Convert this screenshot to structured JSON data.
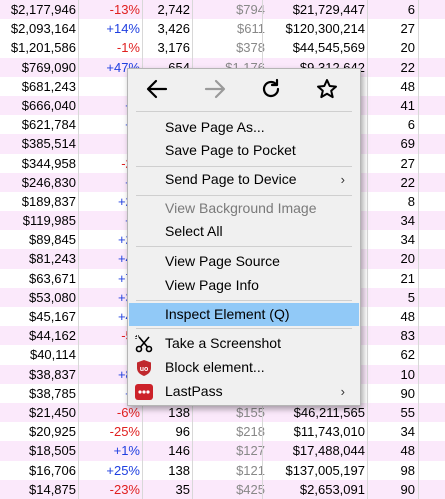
{
  "rows": [
    {
      "c1": "$2,177,946",
      "c2": "-13%",
      "c3": "2,742",
      "c4": "$794",
      "c5": "$21,729,447",
      "c6": "6",
      "style": "alt",
      "sign": "neg"
    },
    {
      "c1": "$2,093,164",
      "c2": "+14%",
      "c3": "3,426",
      "c4": "$611",
      "c5": "$120,300,214",
      "c6": "27",
      "style": "",
      "sign": "pos"
    },
    {
      "c1": "$1,201,586",
      "c2": "-1%",
      "c3": "3,176",
      "c4": "$378",
      "c5": "$44,545,569",
      "c6": "20",
      "style": "",
      "sign": "neg"
    },
    {
      "c1": "$769,090",
      "c2": "+47%",
      "c3": "654",
      "c4": "$1,176",
      "c5": "$9,312,642",
      "c6": "22",
      "style": "alt",
      "sign": "pos"
    },
    {
      "c1": "$681,243",
      "c2": "-3",
      "c3": "",
      "c4": "",
      "c5": "",
      "c6": "48",
      "style": "",
      "sign": "neg"
    },
    {
      "c1": "$666,040",
      "c2": "+5",
      "c3": "",
      "c4": "",
      "c5": "",
      "c6": "41",
      "style": "alt",
      "sign": "pos"
    },
    {
      "c1": "$621,784",
      "c2": "+3",
      "c3": "",
      "c4": "",
      "c5": "",
      "c6": "6",
      "style": "",
      "sign": "pos"
    },
    {
      "c1": "$385,514",
      "c2": "-2",
      "c3": "",
      "c4": "",
      "c5": "",
      "c6": "69",
      "style": "alt",
      "sign": "neg"
    },
    {
      "c1": "$344,958",
      "c2": "-22",
      "c3": "",
      "c4": "",
      "c5": "",
      "c6": "27",
      "style": "",
      "sign": "neg"
    },
    {
      "c1": "$246,830",
      "c2": "+5",
      "c3": "",
      "c4": "",
      "c5": "",
      "c6": "22",
      "style": "alt",
      "sign": "pos"
    },
    {
      "c1": "$189,837",
      "c2": "+21",
      "c3": "",
      "c4": "",
      "c5": "",
      "c6": "8",
      "style": "",
      "sign": "pos"
    },
    {
      "c1": "$119,985",
      "c2": "+8",
      "c3": "",
      "c4": "",
      "c5": "",
      "c6": "34",
      "style": "alt",
      "sign": "pos"
    },
    {
      "c1": "$89,845",
      "c2": "+29",
      "c3": "",
      "c4": "",
      "c5": "",
      "c6": "34",
      "style": "",
      "sign": "pos"
    },
    {
      "c1": "$81,243",
      "c2": "+41",
      "c3": "",
      "c4": "",
      "c5": "",
      "c6": "20",
      "style": "alt",
      "sign": "pos"
    },
    {
      "c1": "$63,671",
      "c2": "+73",
      "c3": "",
      "c4": "",
      "c5": "",
      "c6": "21",
      "style": "",
      "sign": "pos"
    },
    {
      "c1": "$53,080",
      "c2": "+30",
      "c3": "",
      "c4": "",
      "c5": "",
      "c6": "5",
      "style": "alt",
      "sign": "pos"
    },
    {
      "c1": "$45,167",
      "c2": "+45",
      "c3": "",
      "c4": "",
      "c5": "",
      "c6": "48",
      "style": "",
      "sign": "pos"
    },
    {
      "c1": "$44,162",
      "c2": "-51",
      "c3": "",
      "c4": "",
      "c5": "",
      "c6": "83",
      "style": "alt",
      "sign": "neg"
    },
    {
      "c1": "$40,114",
      "c2": "-2",
      "c3": "",
      "c4": "",
      "c5": "",
      "c6": "62",
      "style": "",
      "sign": "neg"
    },
    {
      "c1": "$38,837",
      "c2": "+80",
      "c3": "",
      "c4": "",
      "c5": "",
      "c6": "10",
      "style": "alt",
      "sign": "pos"
    },
    {
      "c1": "$38,785",
      "c2": "+4",
      "c3": "",
      "c4": "",
      "c5": "",
      "c6": "90",
      "style": "",
      "sign": "pos"
    },
    {
      "c1": "$21,450",
      "c2": "-6%",
      "c3": "138",
      "c4": "$155",
      "c5": "$46,211,565",
      "c6": "55",
      "style": "alt",
      "sign": "neg"
    },
    {
      "c1": "$20,925",
      "c2": "-25%",
      "c3": "96",
      "c4": "$218",
      "c5": "$11,743,010",
      "c6": "34",
      "style": "",
      "sign": "neg"
    },
    {
      "c1": "$18,505",
      "c2": "+1%",
      "c3": "146",
      "c4": "$127",
      "c5": "$17,488,044",
      "c6": "48",
      "style": "alt",
      "sign": "pos"
    },
    {
      "c1": "$16,706",
      "c2": "+25%",
      "c3": "138",
      "c4": "$121",
      "c5": "$137,005,197",
      "c6": "98",
      "style": "",
      "sign": "pos"
    },
    {
      "c1": "$14,875",
      "c2": "-23%",
      "c3": "35",
      "c4": "$425",
      "c5": "$2,653,091",
      "c6": "90",
      "style": "alt",
      "sign": "neg"
    }
  ],
  "menu": {
    "nav": {
      "back": "back-arrow-icon",
      "forward": "forward-arrow-icon",
      "reload": "reload-icon",
      "bookmark": "star-icon"
    },
    "items": {
      "save_page_as": "Save Page As...",
      "save_to_pocket": "Save Page to Pocket",
      "send_to_device": "Send Page to Device",
      "view_background_image": "View Background Image",
      "select_all": "Select All",
      "view_page_source": "View Page Source",
      "view_page_info": "View Page Info",
      "inspect_element": "Inspect Element (Q)",
      "take_screenshot": "Take a Screenshot",
      "block_element": "Block element...",
      "lastpass": "LastPass"
    },
    "colors": {
      "highlight": "#91c9f7",
      "ublock": "#c0282d",
      "lastpass": "#cc2229"
    }
  }
}
